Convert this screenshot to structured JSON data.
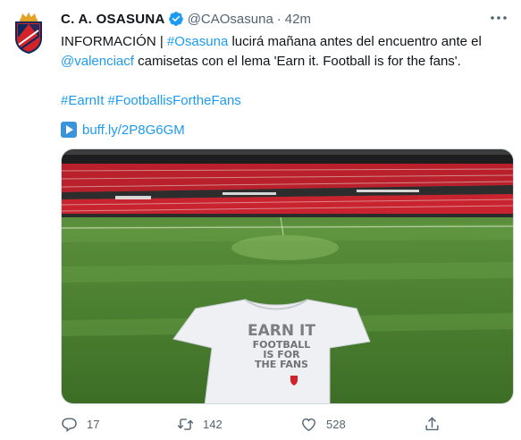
{
  "tweet": {
    "author_name": "C. A. OSASUNA",
    "handle": "@CAOsasuna",
    "separator": "·",
    "time": "42m",
    "text_line1_plain": "INFORMACIÓN | ",
    "hashtag_osasuna": "#Osasuna",
    "text_line1_rest": " lucirá mañana antes del encuentro ante el",
    "mention_valencia": "@valenciacf",
    "text_line2_rest": " camisetas con el lema 'Earn it. Football is for the fans'.",
    "hashtag_earnit": "#EarnIt",
    "hashtag_football": "#FootballisFortheFans",
    "short_url": "buff.ly/2P8G6GM"
  },
  "image": {
    "shirt_line1": "EARN IT",
    "shirt_line2": "FOOTBALL",
    "shirt_line3": "IS FOR",
    "shirt_line4": "THE FANS"
  },
  "actions": {
    "reply_count": "17",
    "retweet_count": "142",
    "like_count": "528"
  },
  "colors": {
    "link": "#1d9bf0",
    "muted": "#536471",
    "verified": "#1d9bf0",
    "club_red": "#d2232a",
    "club_navy": "#0a2a5e"
  },
  "icons": [
    "club-crest-icon",
    "verified-badge-icon",
    "more-options-icon",
    "link-preview-icon",
    "reply-icon",
    "retweet-icon",
    "like-icon",
    "share-icon"
  ]
}
